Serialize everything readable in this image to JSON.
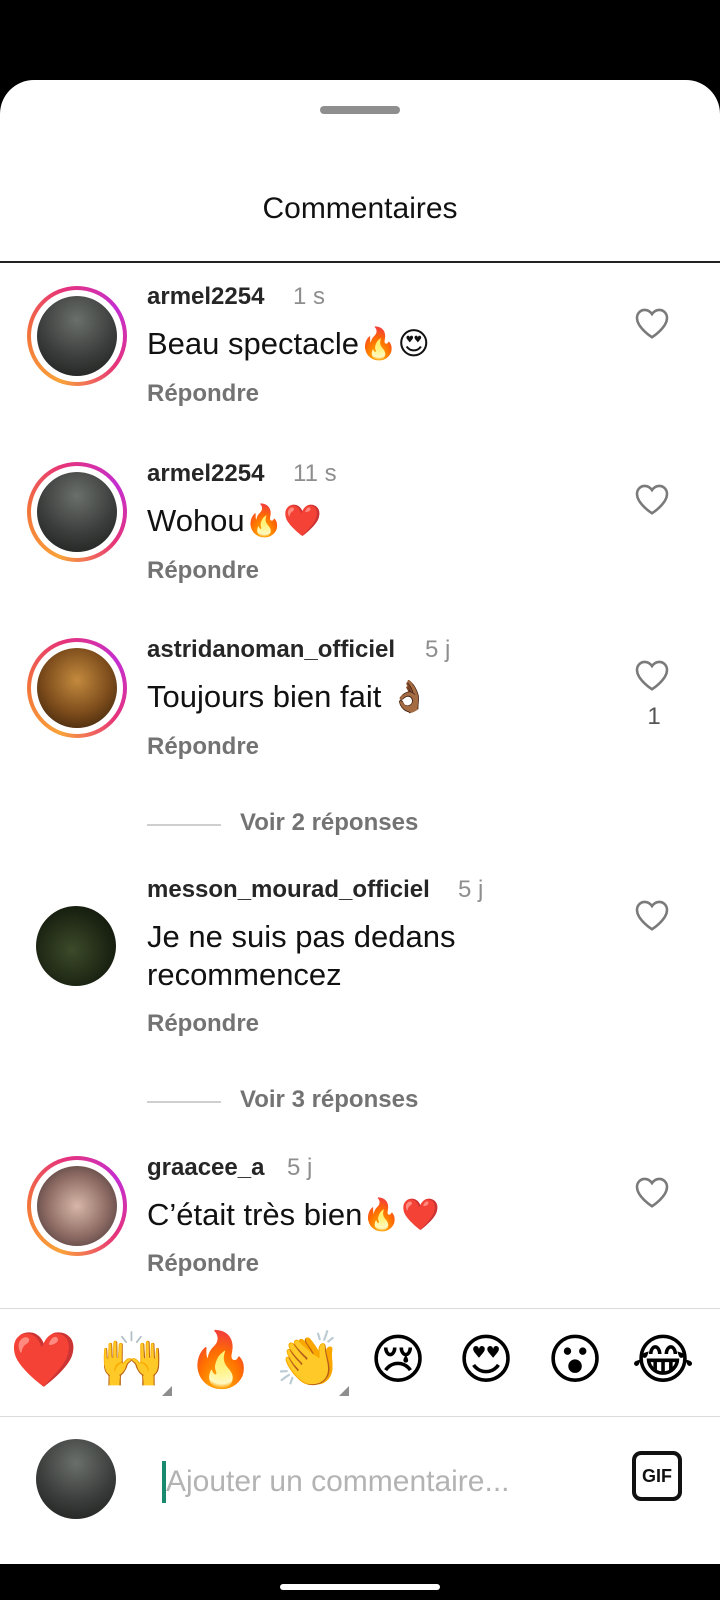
{
  "sheet": {
    "title": "Commentaires"
  },
  "comments": [
    {
      "username": "armel2254",
      "time": "1 s",
      "text": "Beau spectacle🔥😍",
      "reply": "Répondre",
      "likes": ""
    },
    {
      "username": "armel2254",
      "time": "11 s",
      "text": "Wohou🔥❤️",
      "reply": "Répondre",
      "likes": ""
    },
    {
      "username": "astridanoman_officiel",
      "time": "5 j",
      "text": "Toujours bien fait 👌🏾",
      "reply": "Répondre",
      "likes": "1",
      "see_replies": "Voir 2 réponses"
    },
    {
      "username": "messon_mourad_officiel",
      "time": "5 j",
      "text_line1": "Je ne suis pas dedans",
      "text_line2": "recommencez",
      "reply": "Répondre",
      "likes": "",
      "see_replies": "Voir 3 réponses"
    },
    {
      "username": "graacee_a",
      "time": "5 j",
      "text": "C’était très bien🔥❤️",
      "reply": "Répondre",
      "likes": ""
    }
  ],
  "emoji_bar": [
    "❤️",
    "🙌",
    "🔥",
    "👏",
    "😢",
    "😍",
    "😮",
    "😂"
  ],
  "composer": {
    "placeholder": "Ajouter un commentaire...",
    "gif_label": "GIF"
  },
  "colors": {
    "story_ring": "#e6337a",
    "caret": "#1a8a6e"
  }
}
